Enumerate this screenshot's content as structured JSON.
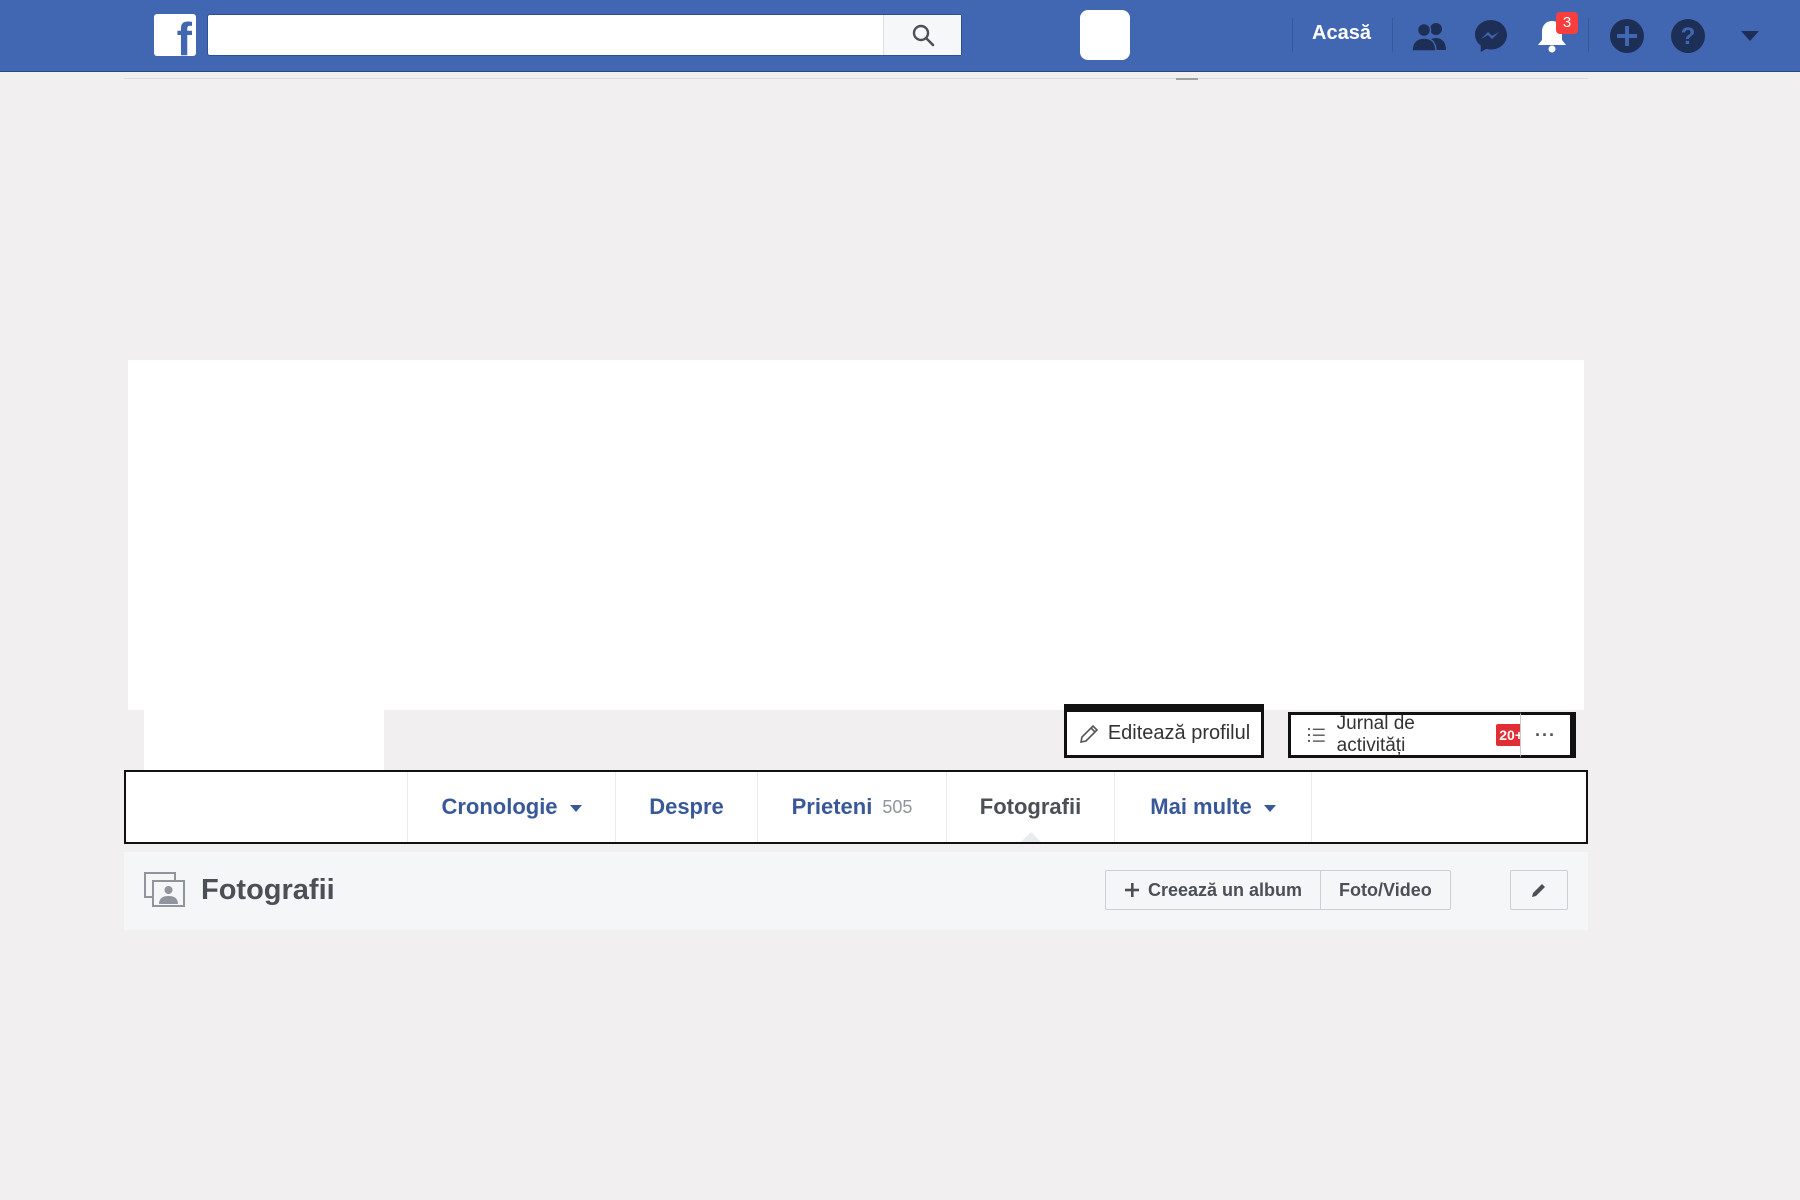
{
  "topbar": {
    "logo_letter": "f",
    "search_value": "",
    "nav_home": "Acasă",
    "notifications_count": "3"
  },
  "profile_actions": {
    "edit_profile": "Editează profilul",
    "activity_log": "Jurnal de activități",
    "activity_badge": "20+",
    "more": "···"
  },
  "profile_nav": {
    "items": [
      {
        "label": "Cronologie"
      },
      {
        "label": "Despre"
      },
      {
        "label": "Prieteni",
        "count": "505"
      },
      {
        "label": "Fotografii"
      },
      {
        "label": "Mai multe"
      }
    ]
  },
  "photos": {
    "title": "Fotografii",
    "create_album": "Creează un album",
    "photo_video": "Foto/Video"
  },
  "colors": {
    "brand": "#4267b2",
    "link": "#385898",
    "badge": "#fa3e3e"
  }
}
